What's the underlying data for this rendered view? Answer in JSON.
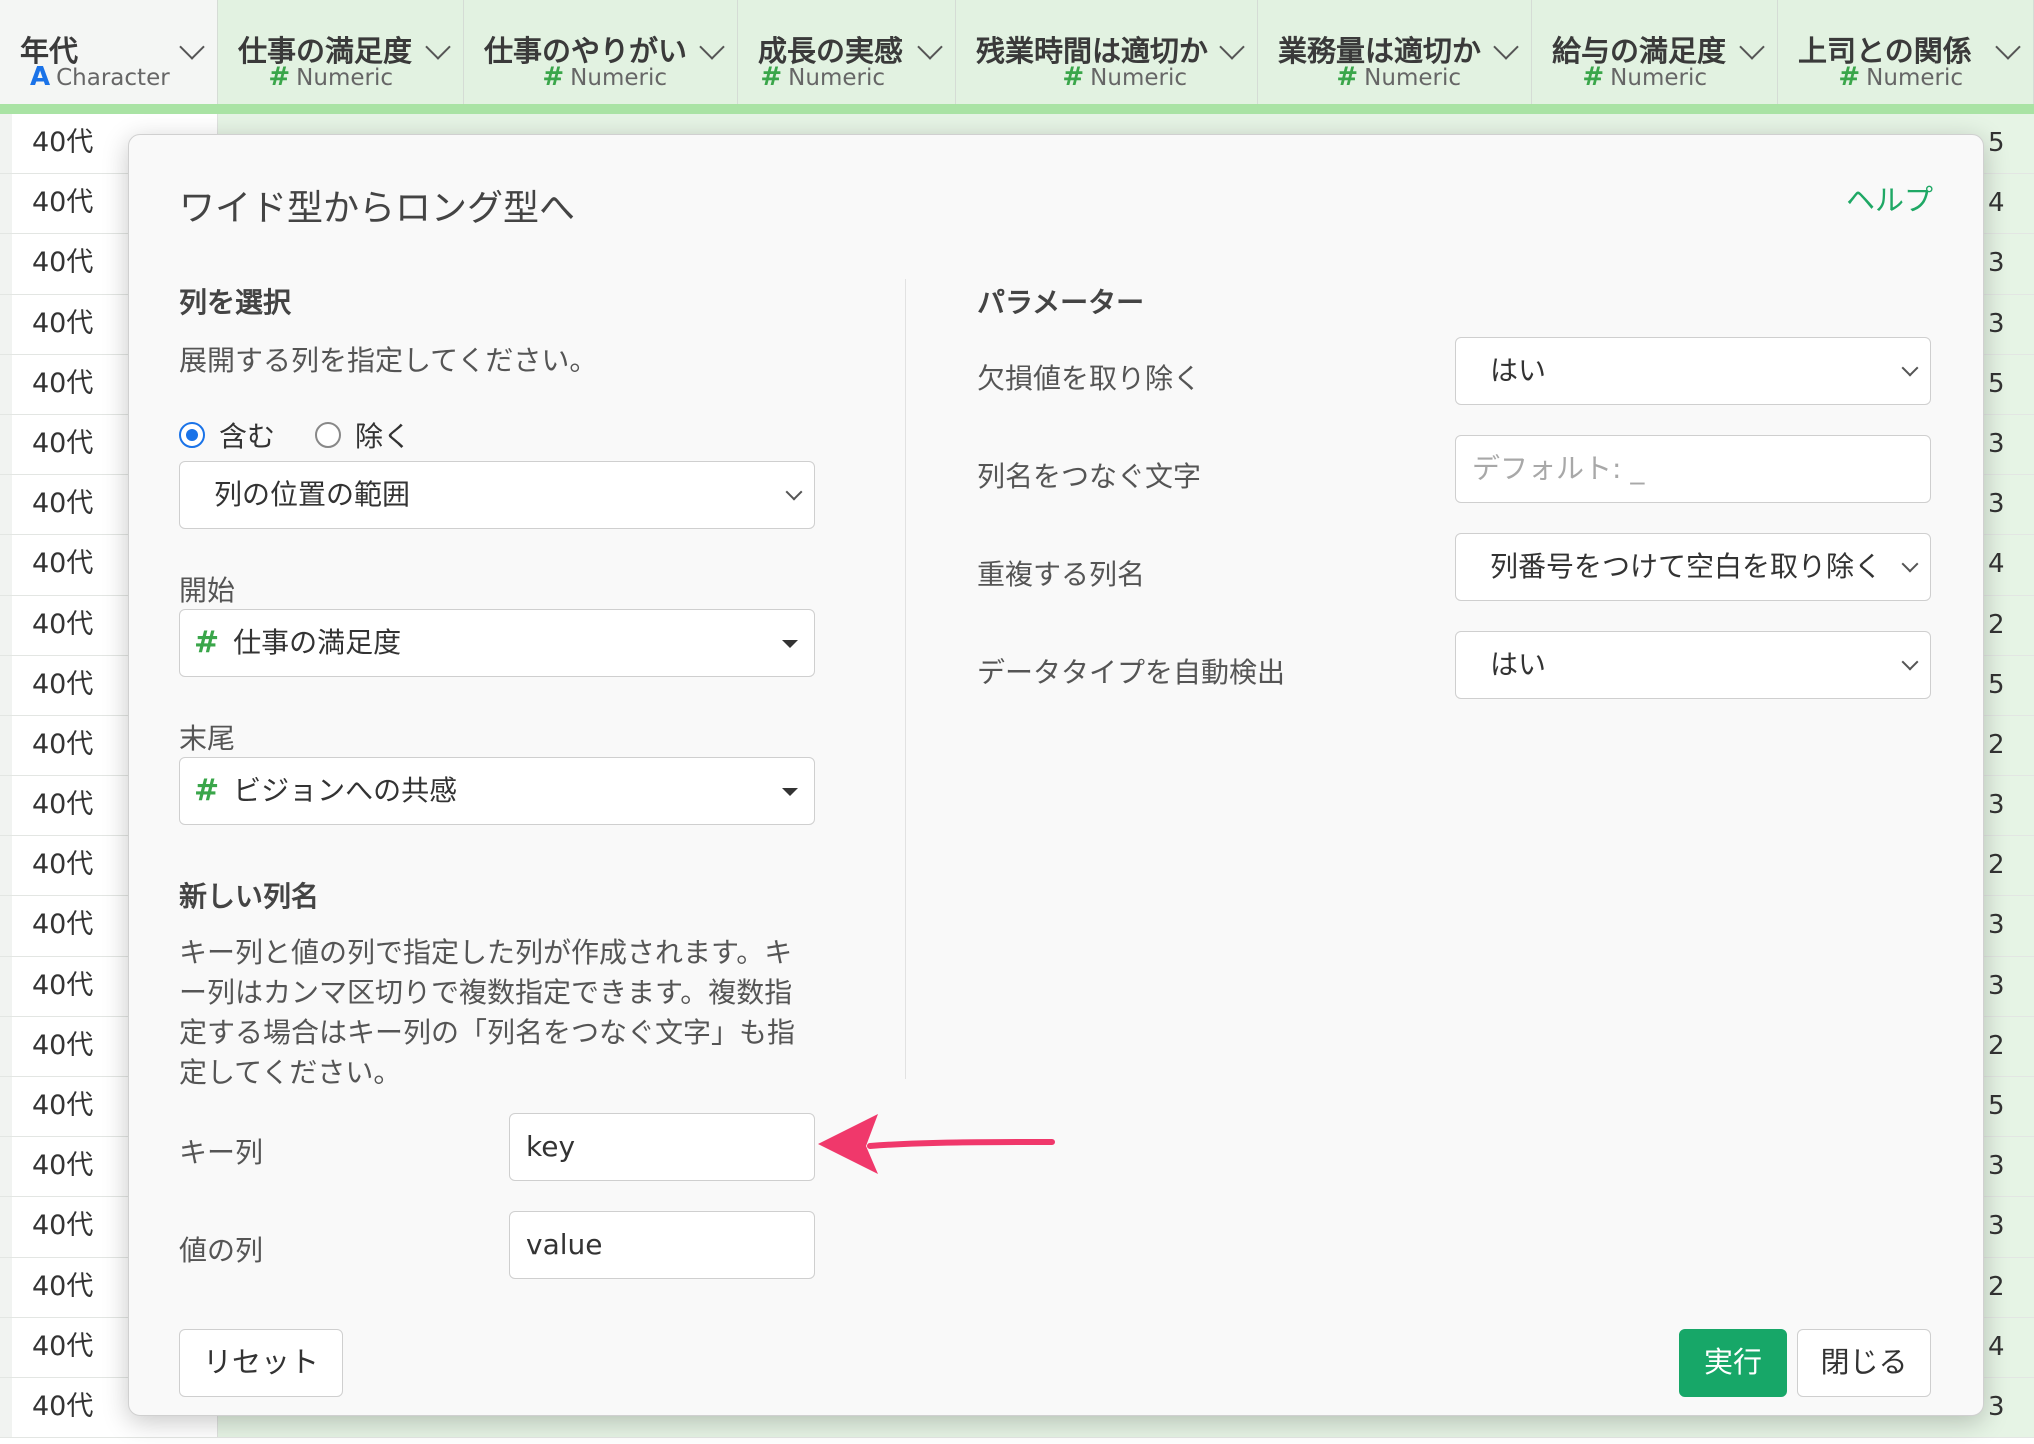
{
  "table": {
    "columns": [
      {
        "name": "年代",
        "type_label": "Character",
        "type_glyph": "A"
      },
      {
        "name": "仕事の満足度",
        "type_label": "Numeric",
        "type_glyph": "#"
      },
      {
        "name": "仕事のやりがい",
        "type_label": "Numeric",
        "type_glyph": "#"
      },
      {
        "name": "成長の実感",
        "type_label": "Numeric",
        "type_glyph": "#"
      },
      {
        "name": "残業時間は適切か",
        "type_label": "Numeric",
        "type_glyph": "#"
      },
      {
        "name": "業務量は適切か",
        "type_label": "Numeric",
        "type_glyph": "#"
      },
      {
        "name": "給与の満足度",
        "type_label": "Numeric",
        "type_glyph": "#"
      },
      {
        "name": "上司との関係",
        "type_label": "Numeric",
        "type_glyph": "#"
      }
    ],
    "rows": [
      {
        "c0": "40代",
        "last": "5"
      },
      {
        "c0": "40代",
        "last": "4"
      },
      {
        "c0": "40代",
        "last": "3"
      },
      {
        "c0": "40代",
        "last": "3"
      },
      {
        "c0": "40代",
        "last": "5"
      },
      {
        "c0": "40代",
        "last": "3"
      },
      {
        "c0": "40代",
        "last": "3"
      },
      {
        "c0": "40代",
        "last": "4"
      },
      {
        "c0": "40代",
        "last": "2"
      },
      {
        "c0": "40代",
        "last": "5"
      },
      {
        "c0": "40代",
        "last": "2"
      },
      {
        "c0": "40代",
        "last": "3"
      },
      {
        "c0": "40代",
        "last": "2"
      },
      {
        "c0": "40代",
        "last": "3"
      },
      {
        "c0": "40代",
        "last": "3"
      },
      {
        "c0": "40代",
        "last": "2"
      },
      {
        "c0": "40代",
        "last": "5"
      },
      {
        "c0": "40代",
        "last": "3"
      },
      {
        "c0": "40代",
        "last": "3"
      },
      {
        "c0": "40代",
        "last": "2"
      },
      {
        "c0": "40代",
        "last": "4"
      },
      {
        "c0": "40代",
        "last": "3"
      }
    ]
  },
  "dialog": {
    "title": "ワイド型からロング型へ",
    "help_label": "ヘルプ",
    "left": {
      "select_cols_title": "列を選択",
      "select_cols_desc": "展開する列を指定してください。",
      "radio_include": "含む",
      "radio_exclude": "除く",
      "radio_selected": "含む",
      "mode_select": "列の位置の範囲",
      "start_label": "開始",
      "start_value": "仕事の満足度",
      "end_label": "末尾",
      "end_value": "ビジョンへの共感",
      "new_names_title": "新しい列名",
      "new_names_desc_lines": [
        "キー列と値の列で指定した列が作成されます。キ",
        "ー列はカンマ区切りで複数指定できます。複数指",
        "定する場合はキー列の「列名をつなぐ文字」も指",
        "定してください。"
      ],
      "key_label": "キー列",
      "key_value": "key",
      "value_label": "値の列",
      "value_value": "value"
    },
    "right": {
      "params_title": "パラメーター",
      "params": [
        {
          "label": "欠損値を取り除く",
          "value": "はい",
          "kind": "select"
        },
        {
          "label": "列名をつなぐ文字",
          "placeholder": "デフォルト: _",
          "kind": "input"
        },
        {
          "label": "重複する列名",
          "value": "列番号をつけて空白を取り除く",
          "kind": "select"
        },
        {
          "label": "データタイプを自動検出",
          "value": "はい",
          "kind": "select"
        }
      ]
    },
    "buttons": {
      "reset": "リセット",
      "run": "実行",
      "close": "閉じる"
    }
  },
  "colors": {
    "accent_green": "#17a768",
    "annotation_arrow": "#f0386b",
    "header_green": "#e2f2e1"
  },
  "icons": {
    "character_type": "A",
    "numeric_type": "#"
  }
}
